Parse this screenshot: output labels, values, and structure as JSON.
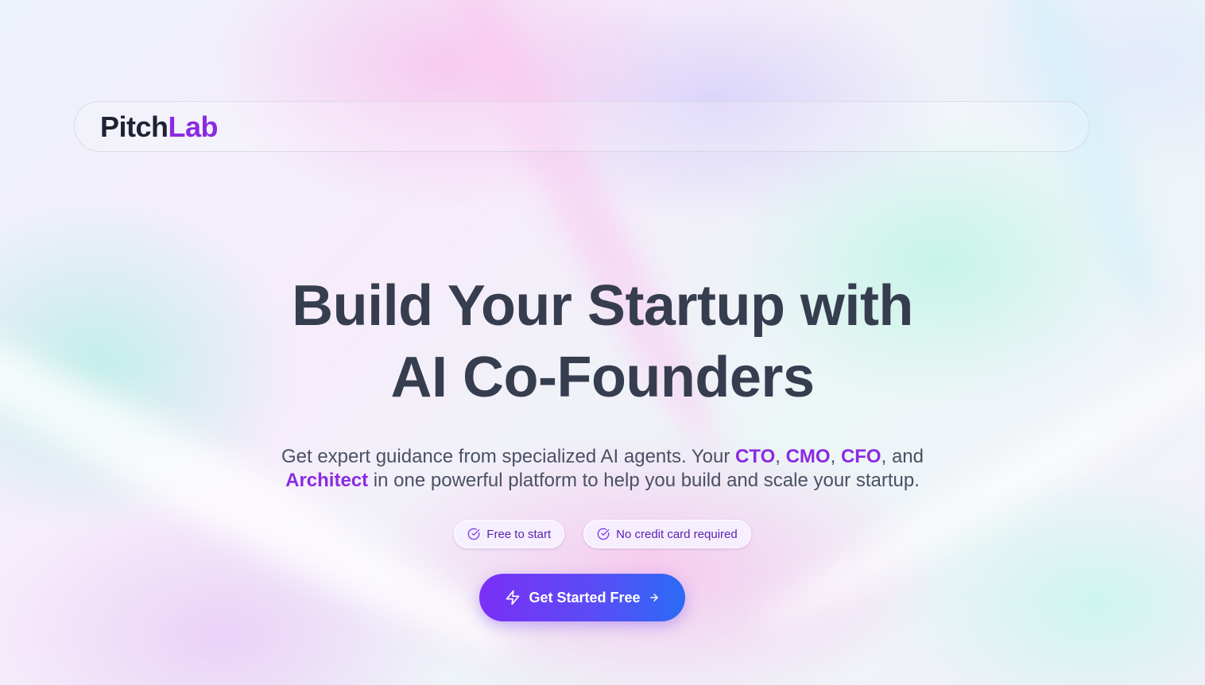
{
  "brand": {
    "name_part1": "Pitch",
    "name_part2": "Lab",
    "accent_color": "#8a2be2"
  },
  "hero": {
    "headline_line1": "Build Your Startup with",
    "headline_line2": "AI Co-Founders",
    "subtitle": {
      "part1": "Get expert guidance from specialized AI agents. Your ",
      "cto": "CTO",
      "sep1": ", ",
      "cmo": "CMO",
      "sep2": ", ",
      "cfo": "CFO",
      "sep3": ", and",
      "architect": "Architect",
      "part2": " in one powerful platform to help you build and scale your startup."
    },
    "badges": [
      {
        "label": "Free to start",
        "icon": "check-circle-icon"
      },
      {
        "label": "No credit card required",
        "icon": "check-circle-icon"
      }
    ],
    "cta": {
      "label": "Get Started Free",
      "left_icon": "lightning-bolt-icon",
      "right_icon": "arrow-right-icon",
      "gradient_start": "#7b2ff7",
      "gradient_end": "#2a6bf5"
    }
  }
}
